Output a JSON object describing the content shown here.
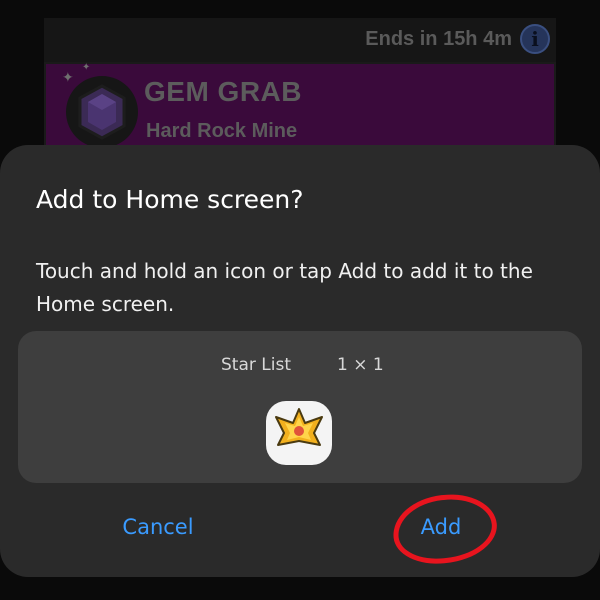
{
  "background": {
    "event_timer": "Ends in 15h 4m",
    "info_icon_glyph": "i",
    "mode_title": "GEM GRAB",
    "map_name": "Hard Rock Mine",
    "icons": [
      "info-icon",
      "gem-icon",
      "sparkle-icon"
    ]
  },
  "dialog": {
    "title": "Add to Home screen?",
    "message": "Touch and hold an icon or tap Add to add it to the Home screen.",
    "widget": {
      "name": "Star List",
      "size": "1 × 1",
      "icon": "star-list-app-icon"
    },
    "buttons": {
      "cancel": "Cancel",
      "add": "Add"
    }
  },
  "colors": {
    "dialog_bg": "#2a2a2a",
    "preview_bg": "#3e3e3e",
    "button_text": "#3a9bff",
    "annotation": "#e8141e",
    "event_band": "#3a0a3b"
  }
}
